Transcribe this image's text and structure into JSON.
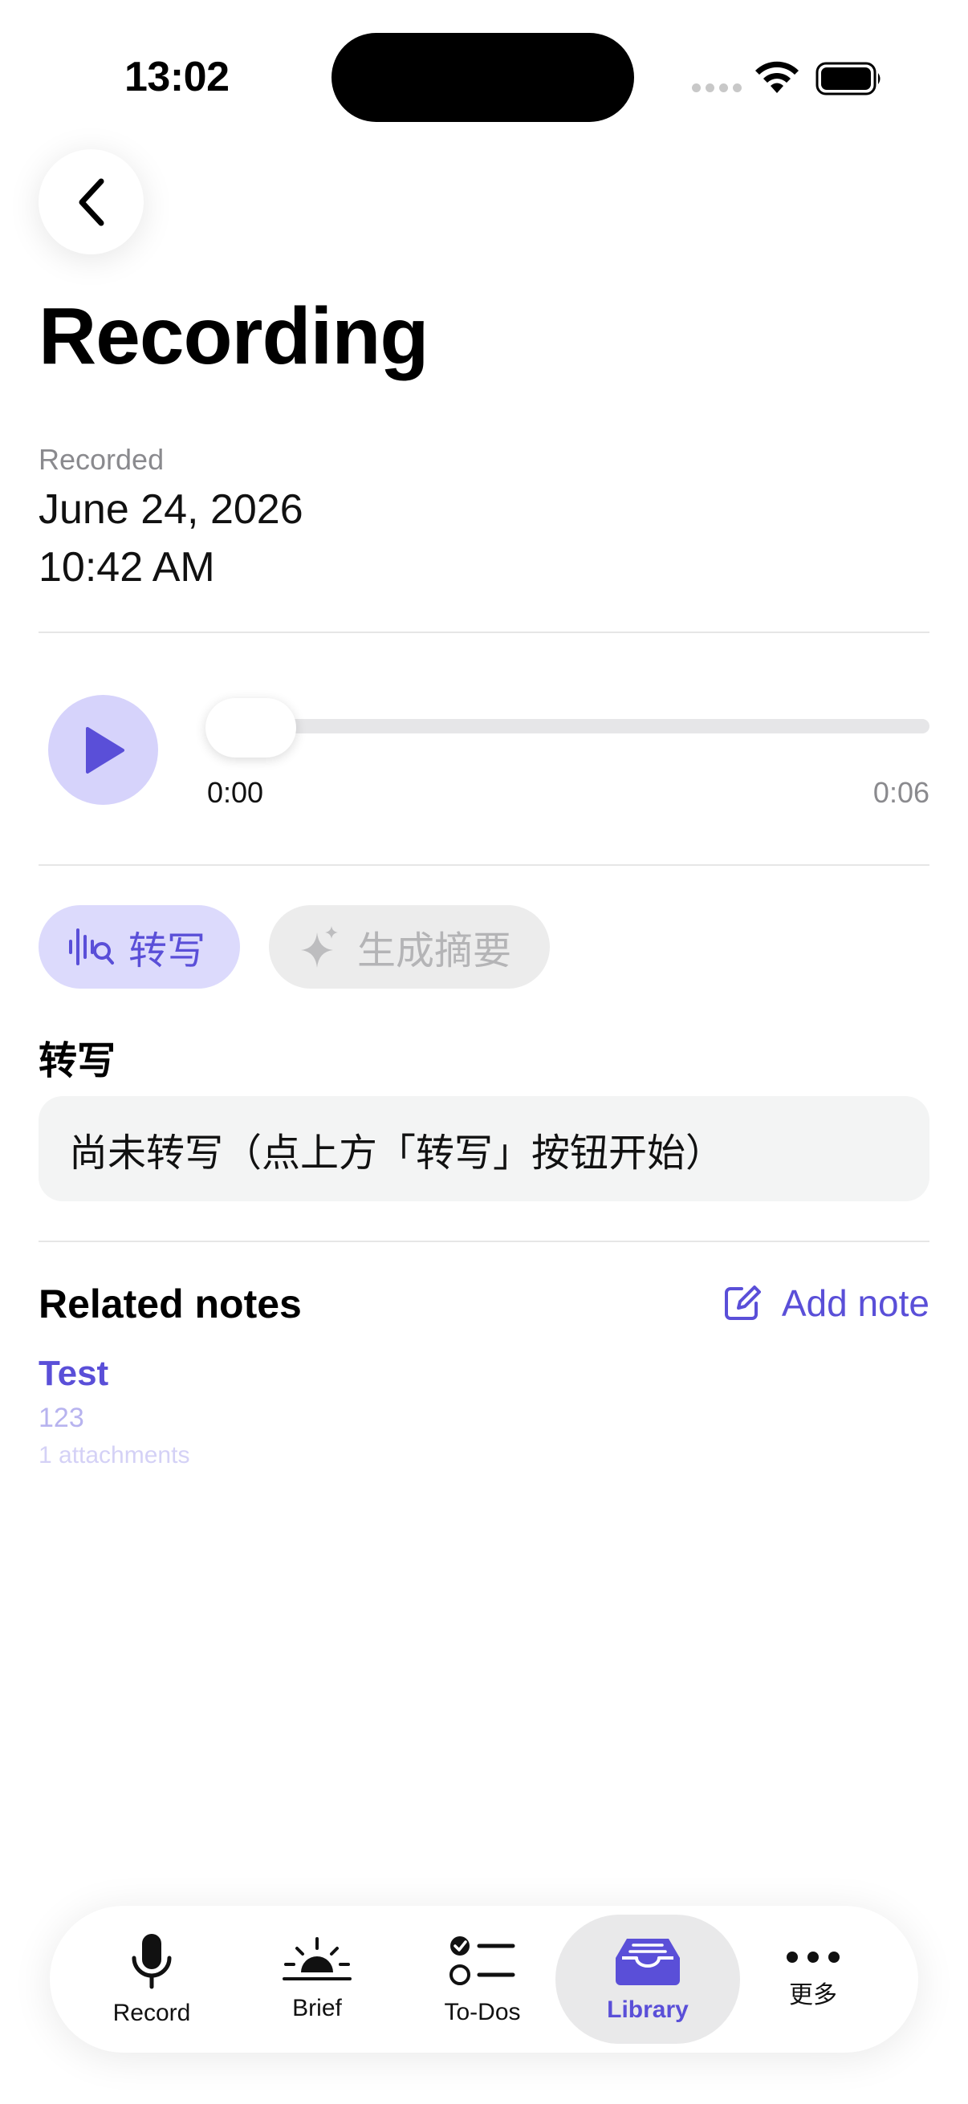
{
  "status_bar": {
    "time": "13:02"
  },
  "header": {
    "title": "Recording"
  },
  "recorded": {
    "label": "Recorded",
    "date": "June 24, 2026",
    "time": "10:42 AM"
  },
  "player": {
    "current_time": "0:00",
    "duration": "0:06",
    "progress": 0
  },
  "actions": {
    "transcribe_label": "转写",
    "summary_label": "生成摘要",
    "summary_enabled": false
  },
  "transcript": {
    "heading": "转写",
    "placeholder": "尚未转写（点上方「转写」按钮开始）"
  },
  "related": {
    "heading": "Related notes",
    "add_label": "Add note",
    "notes": [
      {
        "title": "Test",
        "subtitle": "123",
        "attachments": "1 attachments"
      }
    ]
  },
  "tabbar": {
    "items": [
      {
        "label": "Record",
        "icon": "mic-icon"
      },
      {
        "label": "Brief",
        "icon": "sunrise-icon"
      },
      {
        "label": "To-Dos",
        "icon": "checklist-icon"
      },
      {
        "label": "Library",
        "icon": "tray-icon",
        "active": true
      },
      {
        "label": "更多",
        "icon": "more-icon"
      }
    ]
  },
  "colors": {
    "accent": "#5a4fd8",
    "accent_soft": "#d6d3fb",
    "muted": "#8a8a8e"
  }
}
